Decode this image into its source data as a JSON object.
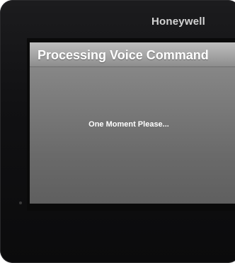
{
  "device": {
    "brand": "Honeywell"
  },
  "screen": {
    "title": "Processing Voice Command",
    "message": "One Moment Please..."
  }
}
